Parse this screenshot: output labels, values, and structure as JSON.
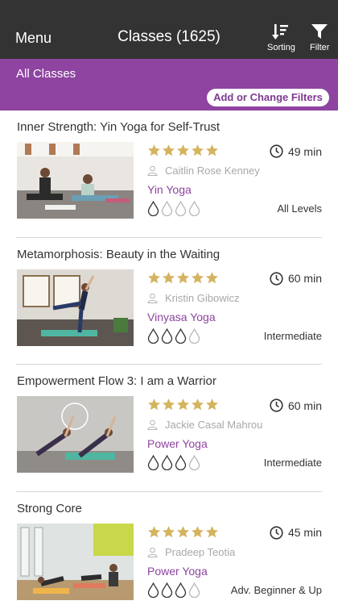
{
  "header": {
    "menu_label": "Menu",
    "title": "Classes (1625)",
    "sorting_label": "Sorting",
    "filter_label": "Filter"
  },
  "filter_bar": {
    "label": "All Classes",
    "add_filters_label": "Add or Change Filters"
  },
  "colors": {
    "topbar": "#333333",
    "accent": "#8e44a0",
    "star": "#d4b45e",
    "muted": "#a8a8a8"
  },
  "classes": [
    {
      "title": "Inner Strength: Yin Yoga for Self-Trust",
      "rating": 5,
      "duration": "49 min",
      "instructor": "Caitlin Rose Kenney",
      "style": "Yin Yoga",
      "intensity": 1,
      "level": "All Levels",
      "thumbnail_icon": "yoga-photo-seated"
    },
    {
      "title": "Metamorphosis: Beauty in the Waiting",
      "rating": 5,
      "duration": "60 min",
      "instructor": "Kristin Gibowicz",
      "style": "Vinyasa Yoga",
      "intensity": 3,
      "level": "Intermediate",
      "thumbnail_icon": "yoga-photo-balance"
    },
    {
      "title": "Empowerment Flow 3: I am a Warrior",
      "rating": 5,
      "duration": "60 min",
      "instructor": "Jackie Casal Mahrou",
      "style": "Power Yoga",
      "intensity": 3,
      "level": "Intermediate",
      "thumbnail_icon": "yoga-photo-side-plank"
    },
    {
      "title": "Strong Core",
      "rating": 5,
      "duration": "45 min",
      "instructor": "Pradeep Teotia",
      "style": "Power Yoga",
      "intensity": 3,
      "level": "Adv. Beginner & Up",
      "thumbnail_icon": "yoga-photo-plank"
    }
  ]
}
